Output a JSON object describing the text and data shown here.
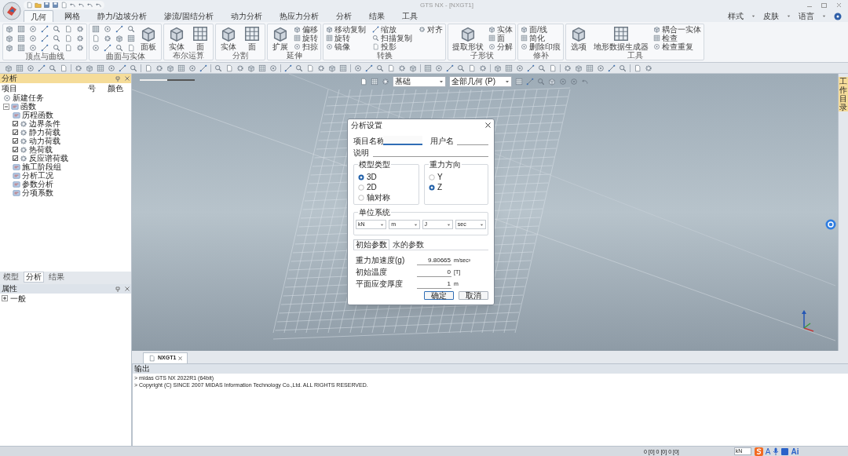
{
  "window": {
    "title": "GTS NX - [NXGT1]"
  },
  "ribbon": {
    "tabs": [
      {
        "label": "几何",
        "selected": true
      },
      {
        "label": "网格",
        "selected": false
      },
      {
        "label": "静力/边坡分析",
        "selected": false
      },
      {
        "label": "渗流/固结分析",
        "selected": false
      },
      {
        "label": "动力分析",
        "selected": false
      },
      {
        "label": "热应力分析",
        "selected": false
      },
      {
        "label": "分析",
        "selected": false
      },
      {
        "label": "结果",
        "selected": false
      },
      {
        "label": "工具",
        "selected": false
      }
    ],
    "right_menu": [
      "样式",
      "皮肤",
      "语言"
    ],
    "groups": [
      {
        "label": "顶点与曲线",
        "kind": "icons"
      },
      {
        "label": "曲面与实体",
        "kind": "icons",
        "large": [
          "面板"
        ]
      },
      {
        "label": "布尔运算",
        "kind": "buttons",
        "large": [
          "实体",
          "面"
        ]
      },
      {
        "label": "分割",
        "kind": "buttons",
        "large": [
          "实体",
          "面"
        ]
      },
      {
        "label": "延伸",
        "kind": "buttons",
        "large": [
          "扩展"
        ],
        "small": [
          "偏移",
          "旋转",
          "扫掠"
        ]
      },
      {
        "label": "转换",
        "kind": "buttons",
        "small": [
          "移动复制",
          "旋转",
          "镜像",
          "缩放",
          "扫描复制",
          "投影",
          "对齐"
        ]
      },
      {
        "label": "子形状",
        "kind": "buttons",
        "large": [
          "提取形状"
        ],
        "small": [
          "实体",
          "面",
          "分解"
        ]
      },
      {
        "label": "修补",
        "kind": "buttons",
        "small": [
          "面/线",
          "简化",
          "删除印痕"
        ]
      },
      {
        "label": "工具",
        "kind": "buttons",
        "large": [
          "选项",
          "地形数据生成器"
        ],
        "small": [
          "耦合一实体",
          "检查",
          "检查重复"
        ]
      }
    ]
  },
  "analysis_panel": {
    "title": "分析",
    "columns": [
      "项目",
      "号",
      "颜色"
    ],
    "tree": [
      {
        "label": "新建任务",
        "kind": "task"
      },
      {
        "label": "函数",
        "kind": "folder",
        "expanded": true,
        "children": [
          {
            "label": "历程函数",
            "kind": "plain"
          },
          {
            "label": "边界条件",
            "kind": "checkbox",
            "checked": true
          },
          {
            "label": "静力荷载",
            "kind": "checkbox",
            "checked": true
          },
          {
            "label": "动力荷载",
            "kind": "checkbox",
            "checked": true
          },
          {
            "label": "热荷载",
            "kind": "checkbox",
            "checked": true
          },
          {
            "label": "反应谱荷载",
            "kind": "checkbox",
            "checked": true
          },
          {
            "label": "施工阶段组",
            "kind": "plain"
          },
          {
            "label": "分析工况",
            "kind": "plain"
          },
          {
            "label": "参数分析",
            "kind": "plain"
          },
          {
            "label": "分项系数",
            "kind": "plain"
          }
        ]
      }
    ],
    "tabs": [
      {
        "label": "模型",
        "selected": false
      },
      {
        "label": "分析",
        "selected": true
      },
      {
        "label": "结果",
        "selected": false
      }
    ]
  },
  "properties_panel": {
    "title": "属性",
    "tree": [
      {
        "label": "一般",
        "expanded": false
      }
    ]
  },
  "viewport": {
    "filter": "基础",
    "selection": "全部几何 (P)",
    "side_tab": "工作目录"
  },
  "dialog": {
    "title": "分析设置",
    "project_label": "项目名称",
    "user_label": "用户名",
    "description_label": "说明",
    "model_type": {
      "label": "模型类型",
      "options": [
        {
          "label": "3D",
          "selected": true
        },
        {
          "label": "2D",
          "selected": false
        },
        {
          "label": "轴对称",
          "selected": false
        }
      ]
    },
    "gravity": {
      "label": "重力方向",
      "options": [
        {
          "label": "Y",
          "selected": false
        },
        {
          "label": "Z",
          "selected": true
        }
      ]
    },
    "units": {
      "label": "单位系统",
      "values": [
        "kN",
        "m",
        "J",
        "sec"
      ]
    },
    "tabs": [
      {
        "label": "初始参数",
        "selected": true
      },
      {
        "label": "水的参数",
        "selected": false
      }
    ],
    "params": [
      {
        "label": "重力加速度(g)",
        "value": "9.80665",
        "unit": "m/sec²"
      },
      {
        "label": "初始温度",
        "value": "0",
        "unit": "[T]"
      },
      {
        "label": "平面应变厚度",
        "value": "1",
        "unit": "m"
      }
    ],
    "buttons": [
      "确定",
      "取消"
    ]
  },
  "doc_tabs": [
    {
      "label": "NXGT1",
      "selected": true
    }
  ],
  "output": {
    "title": "输出",
    "lines": [
      "> midas GTS NX 2022R1 (64bit)",
      "> Copyright (C) SINCE 2007 MIDAS Information Technology Co.,Ltd. ALL RIGHTS RESERVED."
    ]
  },
  "status_bar": {
    "coords": "0 [0] 0 [0] 0 [0]",
    "unit": "kN",
    "ime_mode": "A",
    "ai": "Ai"
  }
}
